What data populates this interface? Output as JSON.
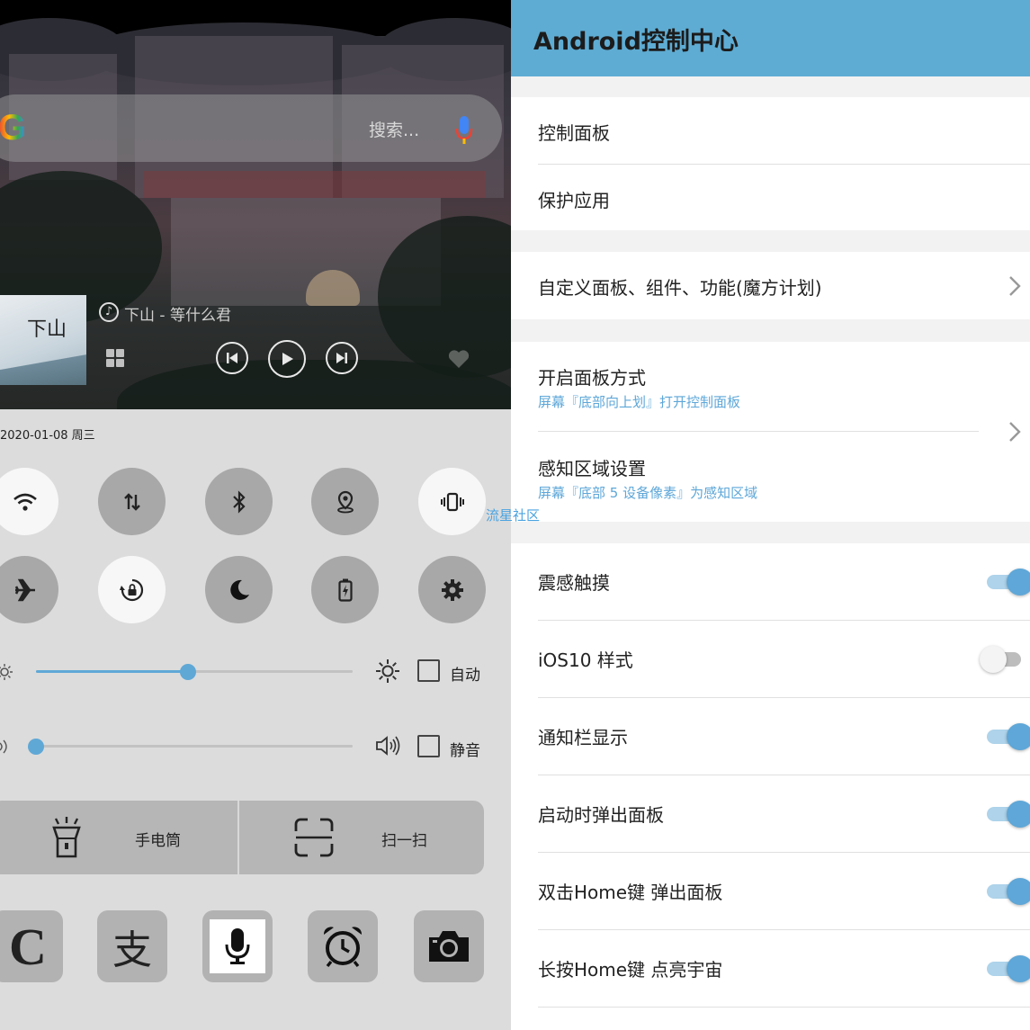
{
  "search": {
    "placeholder": "搜索..."
  },
  "music": {
    "song": "下山 - 等什么君",
    "album_ink": "下山"
  },
  "date": "2020-01-08 周三",
  "quick_toggles": {
    "wifi": true,
    "mobile_data": false,
    "bluetooth": false,
    "location": false,
    "vibrate": true,
    "airplane": false,
    "rotation_lock": true,
    "dnd": false,
    "battery_saver": false,
    "settings": false
  },
  "brightness": {
    "level": 0.48,
    "auto_label": "自动"
  },
  "volume": {
    "level": 0.0,
    "mute_label": "静音"
  },
  "tools": {
    "flashlight": "手电筒",
    "scan": "扫一扫"
  },
  "apps": [
    "C",
    "支",
    "mic",
    "alarm",
    "camera"
  ],
  "watermark": "流星社区",
  "settings": {
    "title": "Android控制中心",
    "group1": [
      "控制面板",
      "保护应用"
    ],
    "group2": [
      "自定义面板、组件、功能(魔方计划)"
    ],
    "open_mode": {
      "label": "开启面板方式",
      "sub": "屏幕『底部向上划』打开控制面板"
    },
    "sense_area": {
      "label": "感知区域设置",
      "sub": "屏幕『底部 5 设备像素』为感知区域"
    },
    "toggles": [
      {
        "label": "震感触摸",
        "on": true
      },
      {
        "label": "iOS10 样式",
        "on": false
      },
      {
        "label": "通知栏显示",
        "on": true
      },
      {
        "label": "启动时弹出面板",
        "on": true
      },
      {
        "label": "双击Home键 弹出面板",
        "on": true
      },
      {
        "label": "长按Home键 点亮宇宙",
        "on": true
      }
    ]
  },
  "colors": {
    "accent": "#5eacd3",
    "toggle_on": "#5ea7d8",
    "sub_text": "#5ea7d8"
  }
}
